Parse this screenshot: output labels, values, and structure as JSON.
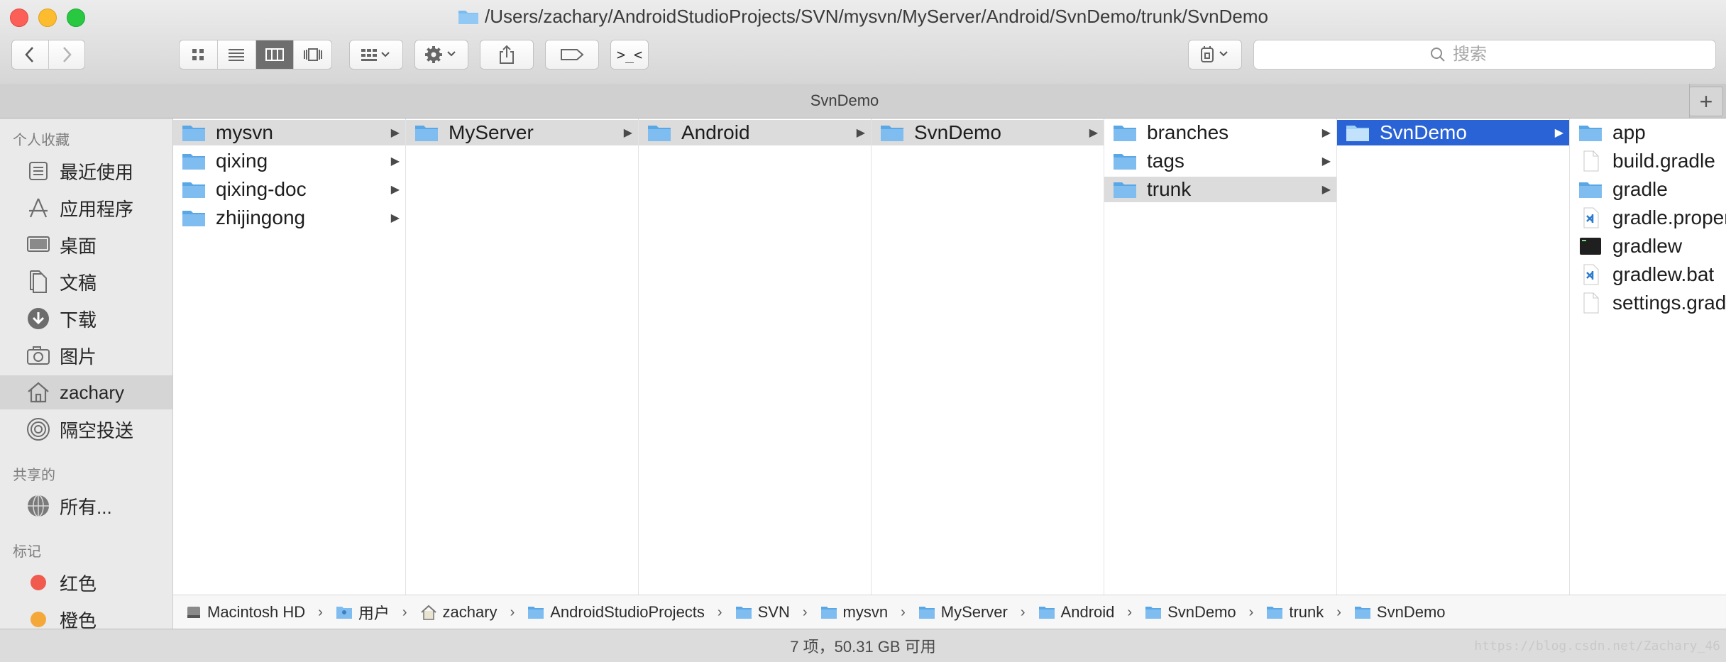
{
  "window": {
    "title": "/Users/zachary/AndroidStudioProjects/SVN/mysvn/MyServer/Android/SvnDemo/trunk/SvnDemo"
  },
  "toolbar": {
    "back_icon": "chevron-left-icon",
    "forward_icon": "chevron-right-icon",
    "view_modes": [
      "icon-view",
      "list-view",
      "column-view",
      "cover-flow-view"
    ],
    "active_view": "column-view",
    "terminal_label": ">_<",
    "search_placeholder": "搜索"
  },
  "tab": {
    "label": "SvnDemo",
    "add_label": "+"
  },
  "sidebar": {
    "sections": [
      {
        "title": "个人收藏",
        "items": [
          {
            "label": "最近使用",
            "icon": "recents-icon"
          },
          {
            "label": "应用程序",
            "icon": "applications-icon"
          },
          {
            "label": "桌面",
            "icon": "desktop-icon"
          },
          {
            "label": "文稿",
            "icon": "documents-icon"
          },
          {
            "label": "下载",
            "icon": "downloads-icon"
          },
          {
            "label": "图片",
            "icon": "camera-icon"
          },
          {
            "label": "zachary",
            "icon": "home-icon",
            "selected": true
          },
          {
            "label": "隔空投送",
            "icon": "airdrop-icon"
          }
        ]
      },
      {
        "title": "共享的",
        "items": [
          {
            "label": "所有...",
            "icon": "network-icon"
          }
        ]
      },
      {
        "title": "标记",
        "items": [
          {
            "label": "红色",
            "color": "#f05b4e"
          },
          {
            "label": "橙色",
            "color": "#f5a83a"
          }
        ]
      }
    ]
  },
  "columns": [
    {
      "items": [
        {
          "name": "mysvn",
          "type": "folder",
          "state": "path",
          "arrow": true
        },
        {
          "name": "qixing",
          "type": "folder",
          "arrow": true
        },
        {
          "name": "qixing-doc",
          "type": "folder",
          "arrow": true
        },
        {
          "name": "zhijingong",
          "type": "folder",
          "arrow": true
        }
      ]
    },
    {
      "items": [
        {
          "name": "MyServer",
          "type": "folder",
          "state": "path",
          "arrow": true
        }
      ]
    },
    {
      "items": [
        {
          "name": "Android",
          "type": "folder",
          "state": "path",
          "arrow": true
        }
      ]
    },
    {
      "items": [
        {
          "name": "SvnDemo",
          "type": "folder",
          "state": "path",
          "arrow": true
        }
      ]
    },
    {
      "items": [
        {
          "name": "branches",
          "type": "folder",
          "arrow": true
        },
        {
          "name": "tags",
          "type": "folder",
          "arrow": true
        },
        {
          "name": "trunk",
          "type": "folder",
          "state": "path",
          "arrow": true
        }
      ]
    },
    {
      "items": [
        {
          "name": "SvnDemo",
          "type": "folder",
          "state": "selected",
          "arrow": true
        }
      ]
    },
    {
      "items": [
        {
          "name": "app",
          "type": "folder"
        },
        {
          "name": "build.gradle",
          "type": "file"
        },
        {
          "name": "gradle",
          "type": "folder"
        },
        {
          "name": "gradle.properties",
          "type": "vscode"
        },
        {
          "name": "gradlew",
          "type": "terminal"
        },
        {
          "name": "gradlew.bat",
          "type": "vscode"
        },
        {
          "name": "settings.gradle",
          "type": "file"
        }
      ]
    }
  ],
  "pathbar": [
    {
      "label": "Macintosh HD",
      "icon": "disk-icon"
    },
    {
      "label": "用户",
      "icon": "users-folder-icon"
    },
    {
      "label": "zachary",
      "icon": "home-icon"
    },
    {
      "label": "AndroidStudioProjects",
      "icon": "folder-icon"
    },
    {
      "label": "SVN",
      "icon": "folder-icon"
    },
    {
      "label": "mysvn",
      "icon": "folder-icon"
    },
    {
      "label": "MyServer",
      "icon": "folder-icon"
    },
    {
      "label": "Android",
      "icon": "folder-icon"
    },
    {
      "label": "SvnDemo",
      "icon": "folder-icon"
    },
    {
      "label": "trunk",
      "icon": "folder-icon"
    },
    {
      "label": "SvnDemo",
      "icon": "folder-icon"
    }
  ],
  "status": {
    "text": "7 项，50.31 GB 可用"
  },
  "watermark": "https://blog.csdn.net/Zachary_46",
  "colors": {
    "selection": "#2a63d6",
    "folder": "#6cb3ee",
    "path_highlight": "#dcdcdc"
  }
}
